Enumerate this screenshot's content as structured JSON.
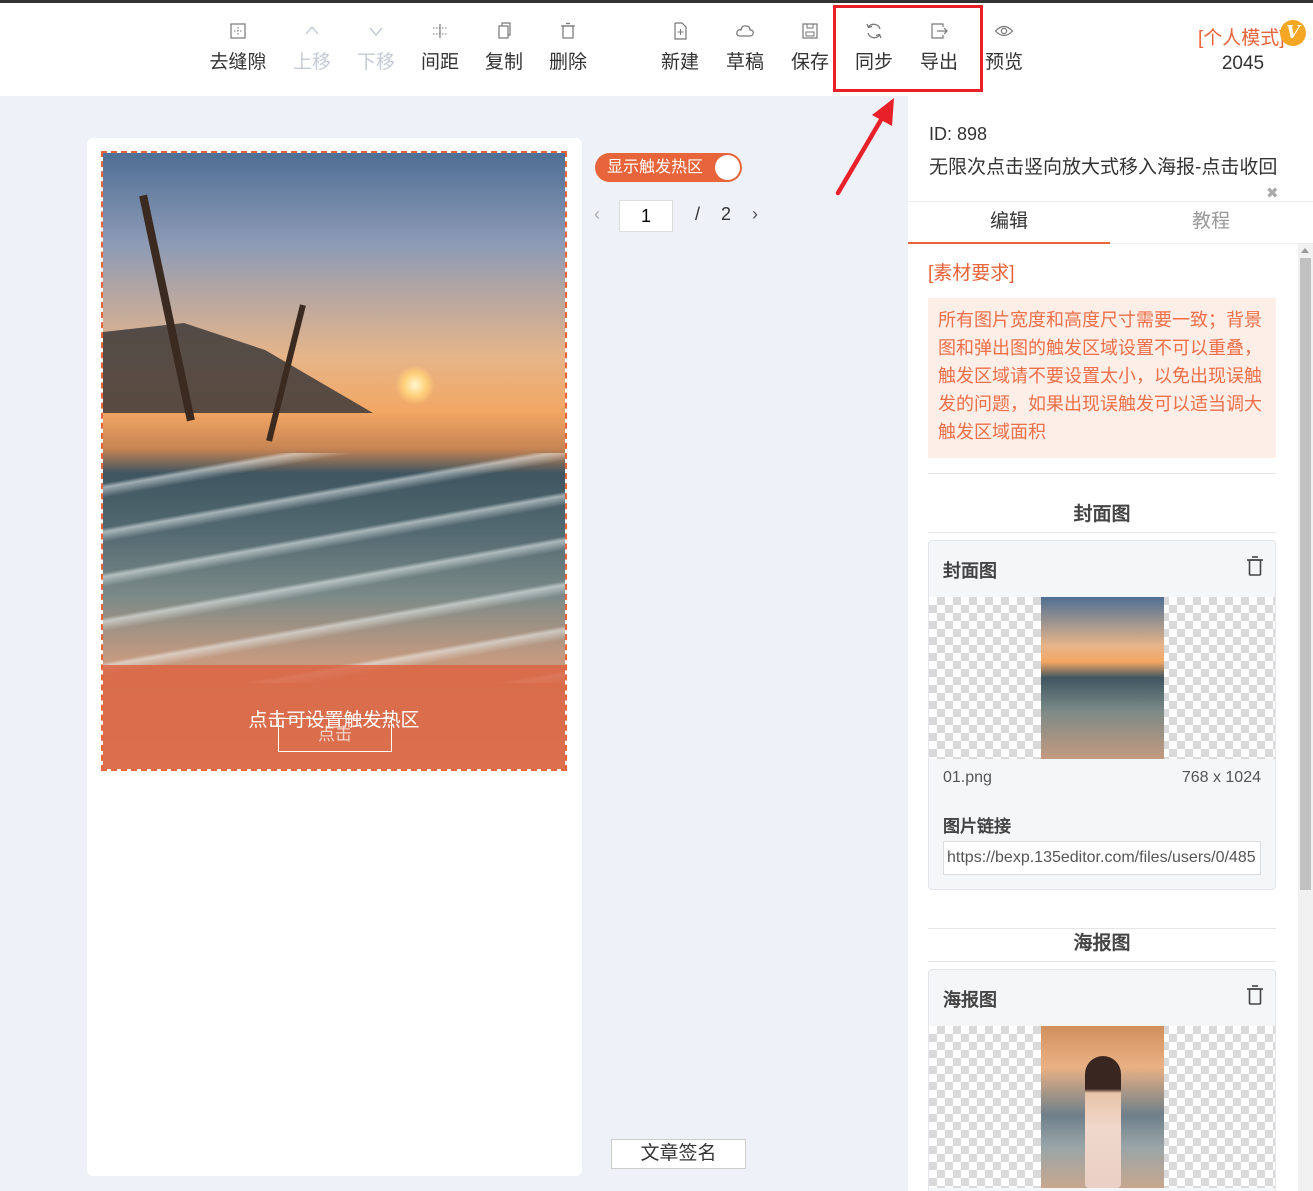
{
  "toolbar": {
    "buttons": [
      {
        "label": "去缝隙",
        "icon": "gap-icon",
        "disabled": false
      },
      {
        "label": "上移",
        "icon": "chevron-up-icon",
        "disabled": true
      },
      {
        "label": "下移",
        "icon": "chevron-down-icon",
        "disabled": true
      },
      {
        "label": "间距",
        "icon": "spacing-icon",
        "disabled": false
      },
      {
        "label": "复制",
        "icon": "copy-icon",
        "disabled": false
      },
      {
        "label": "删除",
        "icon": "trash-icon",
        "disabled": false
      },
      {
        "label": "新建",
        "icon": "new-file-icon",
        "disabled": false
      },
      {
        "label": "草稿",
        "icon": "cloud-icon",
        "disabled": false
      },
      {
        "label": "保存",
        "icon": "save-icon",
        "disabled": false
      },
      {
        "label": "同步",
        "icon": "sync-icon",
        "disabled": false
      },
      {
        "label": "导出",
        "icon": "export-icon",
        "disabled": false
      },
      {
        "label": "预览",
        "icon": "eye-icon",
        "disabled": false
      }
    ],
    "mode_label": "[个人模式]",
    "vip_badge": "V",
    "count": "2045"
  },
  "canvas": {
    "hotzone_hint": "点击可设置触发热区",
    "hotzone_button": "点击"
  },
  "controls": {
    "toggle_label": "显示触发热区",
    "page_current": "1",
    "page_separator": "/",
    "page_total": "2",
    "prev": "‹",
    "next": "›",
    "signature_button": "文章签名"
  },
  "panel": {
    "id_text": "ID: 898",
    "title": "无限次点击竖向放大式移入海报-点击收回",
    "tabs": [
      {
        "label": "编辑",
        "active": true
      },
      {
        "label": "教程",
        "active": false
      }
    ],
    "requirements_label": "[素材要求]",
    "requirements_text": "所有图片宽度和高度尺寸需要一致；背景图和弹出图的触发区域设置不可以重叠，触发区域请不要设置太小，以免出现误触发的问题，如果出现误触发可以适当调大触发区域面积",
    "cover_section": "封面图",
    "cover_card": {
      "title": "封面图",
      "file_name": "01.png",
      "file_size": "768 x 1024",
      "link_label": "图片链接",
      "link_value": "https://bexp.135editor.com/files/users/0/485"
    },
    "poster_section": "海报图",
    "poster_card": {
      "title": "海报图"
    }
  },
  "colors": {
    "accent": "#e8643a",
    "highlight_box": "#e8202a",
    "vip": "#f5a623"
  }
}
